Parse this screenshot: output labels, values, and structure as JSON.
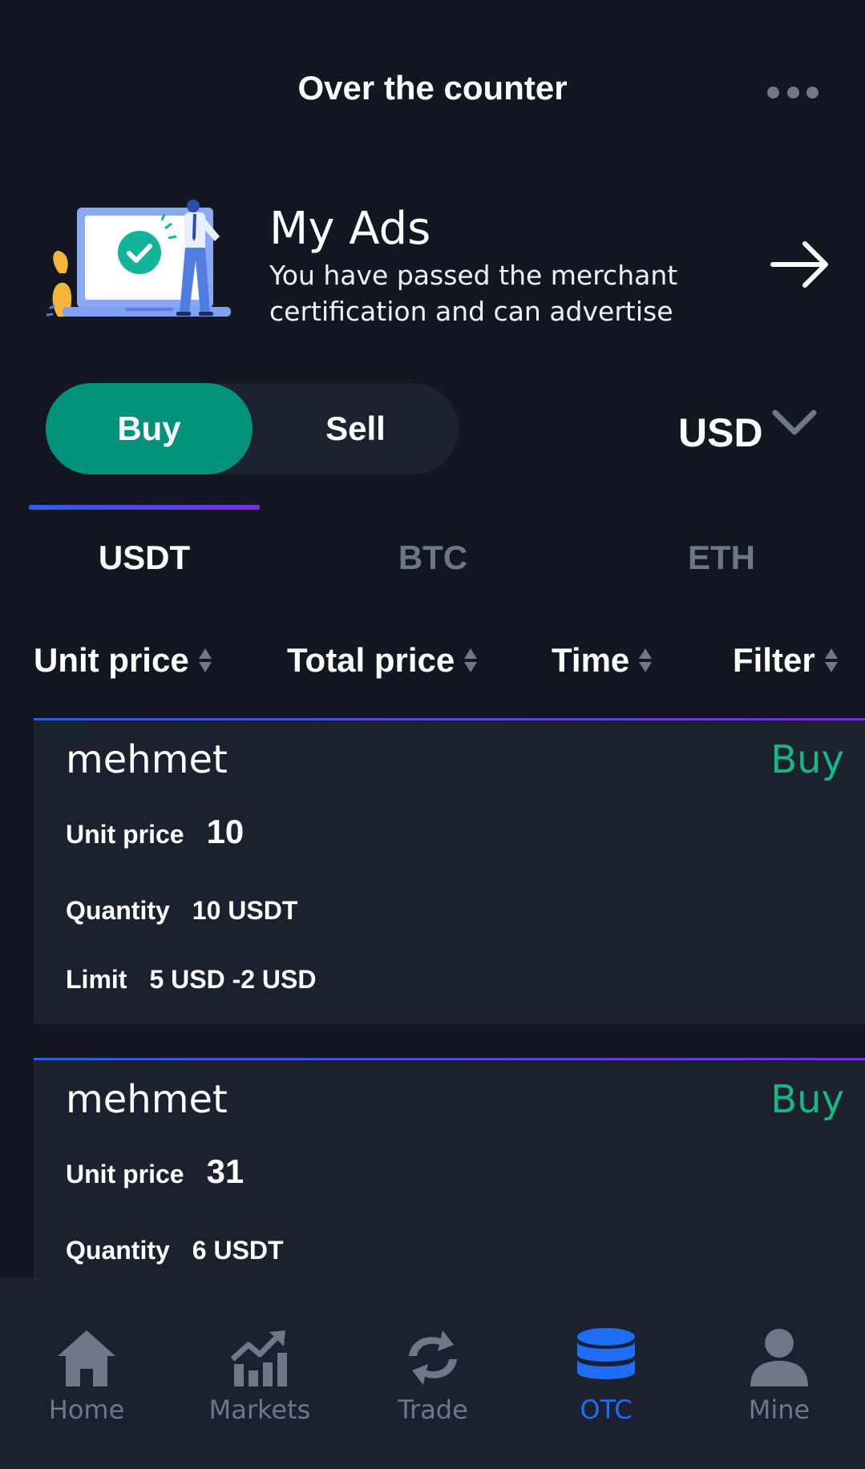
{
  "header": {
    "title": "Over the counter",
    "more_icon": "more-horizontal-icon"
  },
  "ads_banner": {
    "title": "My Ads",
    "description_line1": "You have passed the merchant",
    "description_line2": "certification and can advertise",
    "arrow_icon": "arrow-right-icon"
  },
  "trade_toggle": {
    "buy_label": "Buy",
    "sell_label": "Sell",
    "selected": "Buy"
  },
  "currency": {
    "label": "USD",
    "chevron_icon": "chevron-down-icon"
  },
  "coin_tabs": [
    {
      "label": "USDT",
      "active": true
    },
    {
      "label": "BTC",
      "active": false
    },
    {
      "label": "ETH",
      "active": false
    }
  ],
  "sort_bar": [
    {
      "label": "Unit price"
    },
    {
      "label": "Total price"
    },
    {
      "label": "Time"
    },
    {
      "label": "Filter"
    }
  ],
  "listings": [
    {
      "name": "mehmet",
      "side": "Buy",
      "unit_price_label": "Unit price",
      "unit_price": "10",
      "quantity_label": "Quantity",
      "quantity": "10 USDT",
      "limit_label": "Limit",
      "limit": "5 USD -2 USD"
    },
    {
      "name": "mehmet",
      "side": "Buy",
      "unit_price_label": "Unit price",
      "unit_price": "31",
      "quantity_label": "Quantity",
      "quantity": "6 USDT"
    }
  ],
  "bottom_nav": [
    {
      "label": "Home",
      "icon": "home-icon",
      "active": false
    },
    {
      "label": "Markets",
      "icon": "markets-chart-icon",
      "active": false
    },
    {
      "label": "Trade",
      "icon": "trade-exchange-icon",
      "active": false
    },
    {
      "label": "OTC",
      "icon": "otc-database-icon",
      "active": true
    },
    {
      "label": "Mine",
      "icon": "user-icon",
      "active": false
    }
  ],
  "colors": {
    "background": "#121722",
    "card": "#1c2130",
    "accent_green": "#00927a",
    "buy_text": "#17b784",
    "active_blue": "#1f6cf5",
    "muted": "#6e7787"
  }
}
